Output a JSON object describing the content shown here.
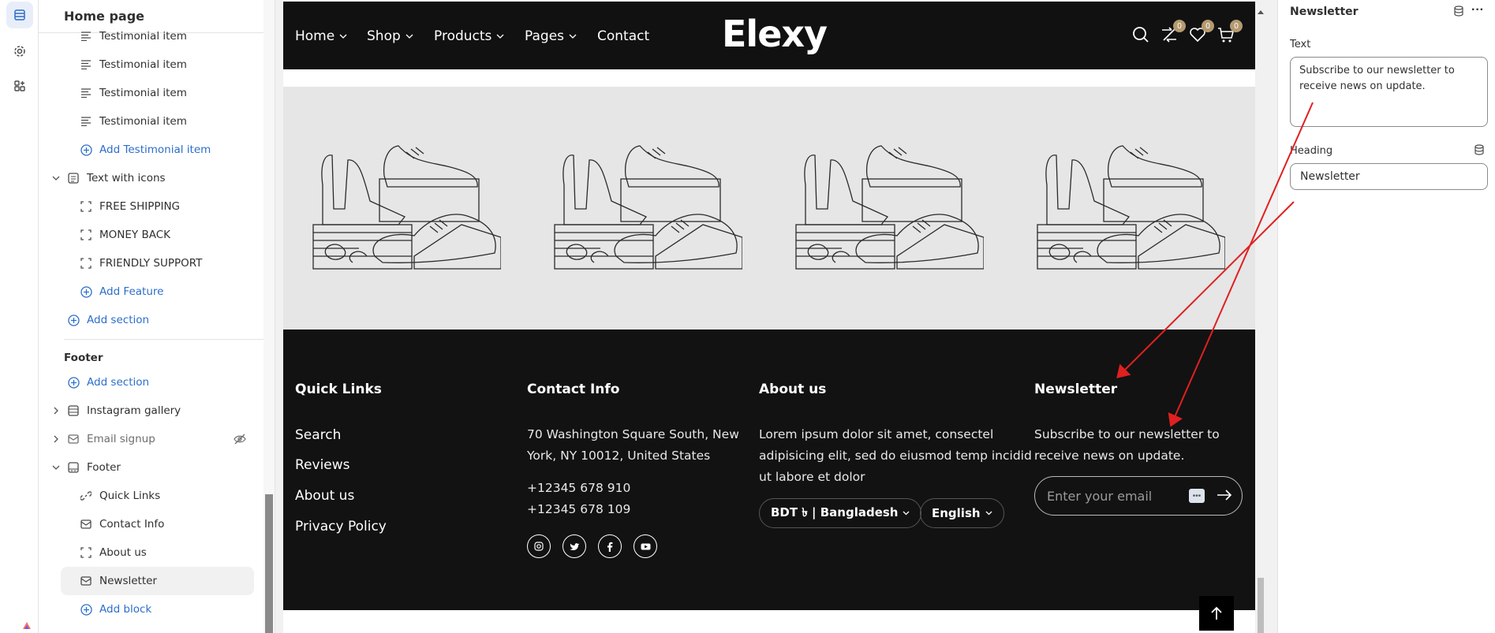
{
  "sidebar": {
    "title": "Home page",
    "items": [
      {
        "label": "Testimonial item"
      },
      {
        "label": "Testimonial item"
      },
      {
        "label": "Testimonial item"
      },
      {
        "label": "Testimonial item"
      },
      {
        "label": "Add Testimonial item"
      },
      {
        "label": "Text with icons"
      },
      {
        "label": "FREE SHIPPING"
      },
      {
        "label": "MONEY BACK"
      },
      {
        "label": "FRIENDLY SUPPORT"
      },
      {
        "label": "Add Feature"
      },
      {
        "label": "Add section"
      },
      {
        "label": "Footer"
      },
      {
        "label": "Add section"
      },
      {
        "label": "Instagram gallery"
      },
      {
        "label": "Email signup"
      },
      {
        "label": "Footer"
      },
      {
        "label": "Quick Links"
      },
      {
        "label": "Contact Info"
      },
      {
        "label": "About us"
      },
      {
        "label": "Newsletter"
      },
      {
        "label": "Add block"
      }
    ]
  },
  "store": {
    "nav": [
      "Home",
      "Shop",
      "Products",
      "Pages",
      "Contact"
    ],
    "logo": "Elexy",
    "badges": [
      "0",
      "0",
      "0"
    ],
    "footer": {
      "quick_links": {
        "heading": "Quick Links",
        "links": [
          "Search",
          "Reviews",
          "About us",
          "Privacy Policy"
        ]
      },
      "contact": {
        "heading": "Contact Info",
        "address_1": "70 Washington Square South, New",
        "address_2": "York, NY 10012, United States",
        "phone_1": "+12345 678 910",
        "phone_2": "+12345 678 109"
      },
      "about": {
        "heading": "About us",
        "text_1": "Lorem ipsum dolor sit amet, consectel",
        "text_2": "adipisicing elit, sed do eiusmod temp incidid",
        "text_3": "ut labore et dolor",
        "currency": "BDT ৳ | Bangladesh",
        "language": "English"
      },
      "newsletter": {
        "heading": "Newsletter",
        "text_1": "Subscribe to our newsletter to",
        "text_2": "receive news on update.",
        "email_placeholder": "Enter your email"
      }
    }
  },
  "panel": {
    "title": "Newsletter",
    "text_label": "Text",
    "text_value": "Subscribe to our newsletter to receive news on update.",
    "heading_label": "Heading",
    "heading_value": "Newsletter"
  },
  "colors": {
    "accent": "#2c6ecb",
    "footer_bg": "#121212",
    "badge": "#b59a70",
    "annotation": "#e02020"
  }
}
